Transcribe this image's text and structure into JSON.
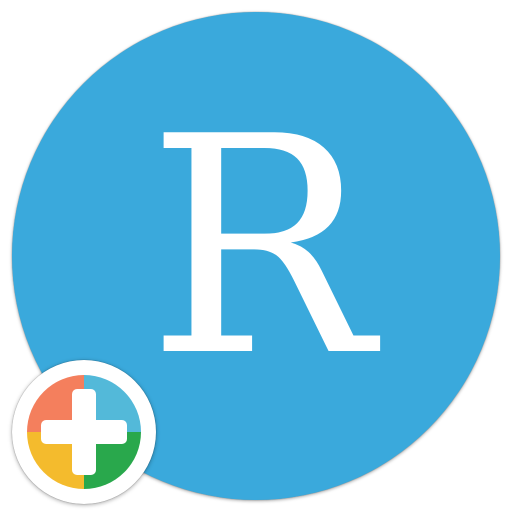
{
  "app_icon": {
    "letter": "R",
    "background_color": "#3aa9dc",
    "letter_color": "#ffffff"
  },
  "badge": {
    "icon": "plus-icon",
    "quadrant_colors": {
      "top_left": "#f47f5d",
      "top_right": "#53b9d9",
      "bottom_left": "#f4bb2d",
      "bottom_right": "#29a84c"
    },
    "plus_color": "#ffffff"
  }
}
